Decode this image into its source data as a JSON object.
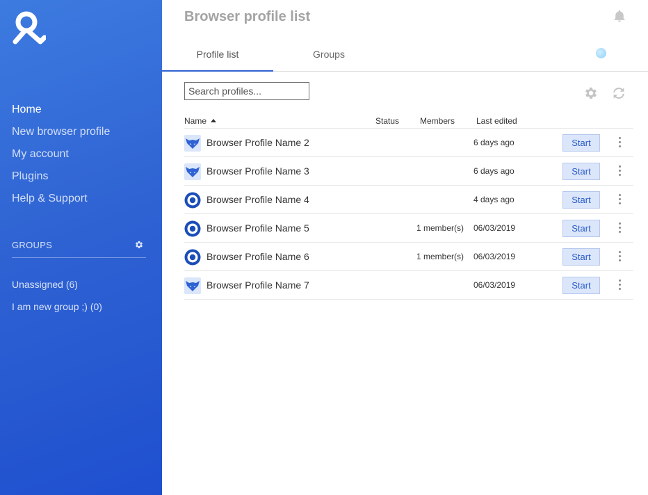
{
  "sidebar": {
    "nav": [
      {
        "label": "Home",
        "active": true
      },
      {
        "label": "New browser profile",
        "active": false
      },
      {
        "label": "My account",
        "active": false
      },
      {
        "label": "Plugins",
        "active": false
      },
      {
        "label": "Help & Support",
        "active": false
      }
    ],
    "groups_title": "GROUPS",
    "groups": [
      {
        "label": "Unassigned (6)"
      },
      {
        "label": "I am new group ;) (0)"
      }
    ],
    "gradient_colors": [
      "#3d7be0",
      "#1f4fcf"
    ]
  },
  "header": {
    "title": "Browser profile list",
    "icons": [
      "bell-icon",
      "status-dot"
    ]
  },
  "tabs": [
    {
      "label": "Profile list",
      "active": true
    },
    {
      "label": "Groups",
      "active": false
    }
  ],
  "toolbar": {
    "search_placeholder": "Search profiles...",
    "search_value": "",
    "icons": [
      "gear-icon",
      "refresh-icon"
    ]
  },
  "table": {
    "columns": {
      "name": "Name",
      "status": "Status",
      "members": "Members",
      "last_edited": "Last edited"
    },
    "sort": {
      "column": "name",
      "direction": "asc"
    },
    "start_label": "Start",
    "rows": [
      {
        "icon": "fox-icon",
        "name": "Browser Profile Name 2",
        "status": "",
        "members": "",
        "last_edited": "6 days ago"
      },
      {
        "icon": "fox-icon",
        "name": "Browser Profile Name 3",
        "status": "",
        "members": "",
        "last_edited": "6 days ago"
      },
      {
        "icon": "ring-icon",
        "name": "Browser Profile Name 4",
        "status": "",
        "members": "",
        "last_edited": "4 days ago"
      },
      {
        "icon": "ring-icon",
        "name": "Browser Profile Name 5",
        "status": "",
        "members": "1 member(s)",
        "last_edited": "06/03/2019"
      },
      {
        "icon": "ring-icon",
        "name": "Browser Profile Name 6",
        "status": "",
        "members": "1 member(s)",
        "last_edited": "06/03/2019"
      },
      {
        "icon": "fox-icon",
        "name": "Browser Profile Name 7",
        "status": "",
        "members": "",
        "last_edited": "06/03/2019"
      }
    ]
  },
  "colors": {
    "accent": "#2f63d3",
    "start_button_bg": "#dbe6fb",
    "start_button_text": "#2a5bc9"
  }
}
